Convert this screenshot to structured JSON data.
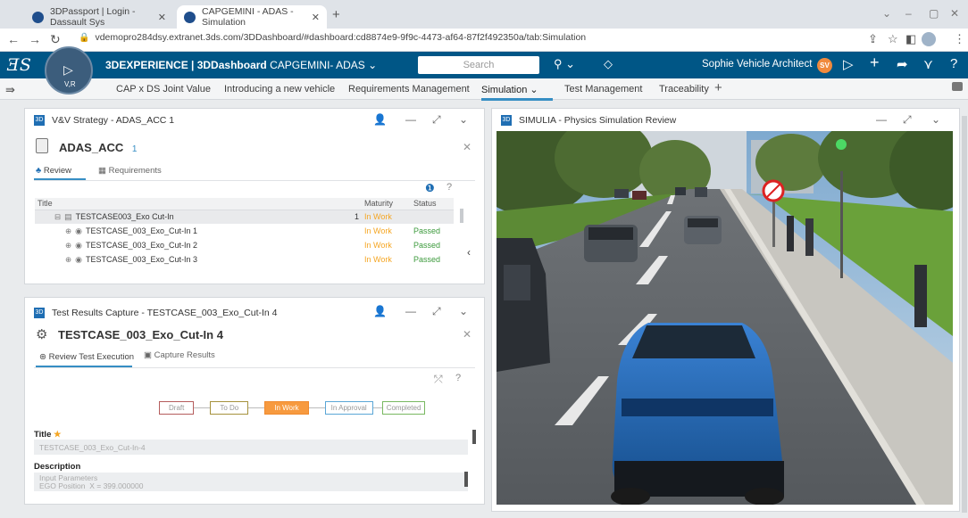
{
  "browser": {
    "tabs": [
      {
        "label": "3DPassport | Login - Dassault Sys"
      },
      {
        "label": "CAPGEMINI - ADAS - Simulation"
      }
    ],
    "url": "vdemopro284dsy.extranet.3ds.com/3DDashboard/#dashboard:cd8874e9-9f9c-4473-af64-87f2f492350a/tab:Simulation"
  },
  "topbar": {
    "brand_bold": "3DEXPERIENCE | 3DDashboard",
    "brand_rest": "CAPGEMINI- ADAS",
    "compass_label": "V,R",
    "search_placeholder": "Search",
    "user_name": "Sophie Vehicle Architect",
    "user_initials": "SV"
  },
  "dashboard_tabs": [
    {
      "label": "CAP x DS Joint Value"
    },
    {
      "label": "Introducing a new vehicle"
    },
    {
      "label": "Requirements Management"
    },
    {
      "label": "Simulation",
      "active": true
    },
    {
      "label": "Test Management"
    },
    {
      "label": "Traceability"
    }
  ],
  "vv_panel": {
    "title": "V&V Strategy - ADAS_ACC 1",
    "object_name": "ADAS_ACC",
    "object_rev": "1",
    "subtabs": [
      "Review",
      "Requirements"
    ],
    "columns": [
      "Title",
      "Maturity",
      "Status"
    ],
    "rows": [
      {
        "title": "TESTCASE003_Exo Cut-In",
        "count": "1",
        "maturity": "In Work",
        "status": ""
      },
      {
        "title": "TESTCASE_003_Exo_Cut-In 1",
        "count": "",
        "maturity": "In Work",
        "status": "Passed"
      },
      {
        "title": "TESTCASE_003_Exo_Cut-In 2",
        "count": "",
        "maturity": "In Work",
        "status": "Passed"
      },
      {
        "title": "TESTCASE_003_Exo_Cut-In 3",
        "count": "",
        "maturity": "In Work",
        "status": "Passed"
      }
    ]
  },
  "trc_panel": {
    "title": "Test Results Capture - TESTCASE_003_Exo_Cut-In 4",
    "object_name": "TESTCASE_003_Exo_Cut-In 4",
    "subtabs": [
      "Review Test Execution",
      "Capture Results"
    ],
    "lifecycle": [
      "Draft",
      "To Do",
      "In Work",
      "In Approval",
      "Completed"
    ],
    "title_label": "Title",
    "title_value": "TESTCASE_003_Exo_Cut-In-4",
    "description_label": "Description",
    "description_line1": "Input Parameters",
    "description_line2": "EGO Position_X = 399.000000"
  },
  "sim_panel": {
    "title": "SIMULIA - Physics Simulation Review"
  },
  "colors": {
    "topbar": "#005686",
    "accent": "#368ec4",
    "maturity": "#f5a623",
    "passed": "#3c9a3c",
    "in_work_state": "#f79a3f"
  }
}
